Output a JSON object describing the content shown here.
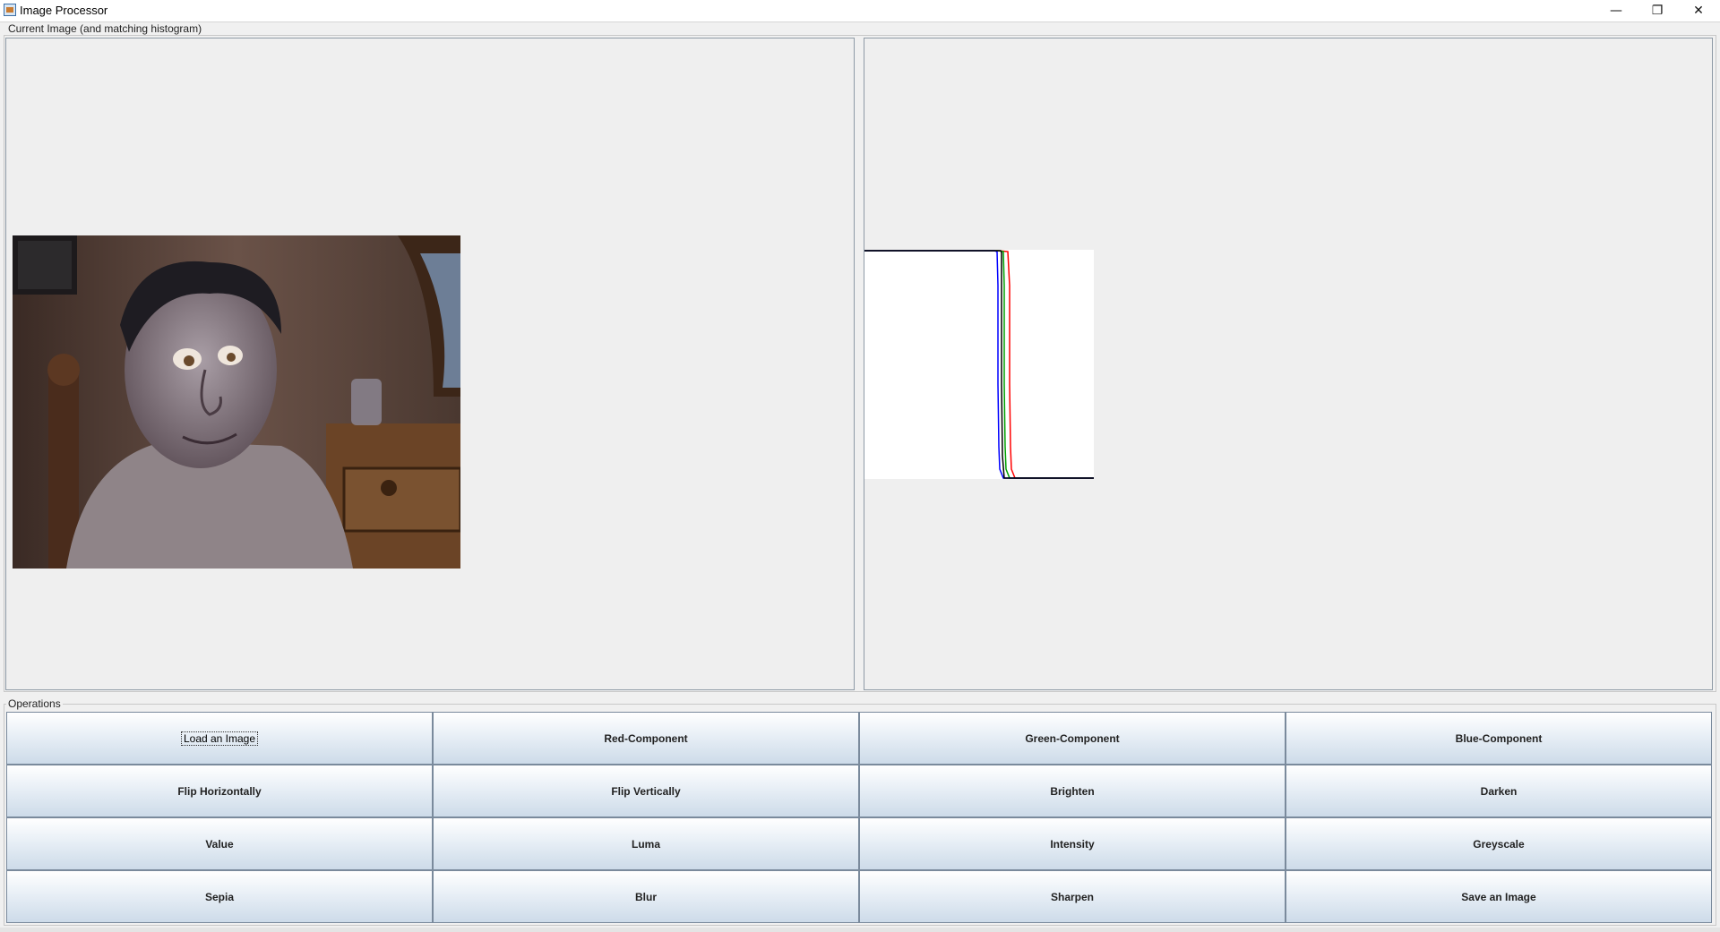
{
  "window": {
    "title": "Image Processor",
    "minimize_glyph": "—",
    "maximize_glyph": "❐",
    "close_glyph": "✕"
  },
  "image_group": {
    "title": "Current Image (and matching histogram)"
  },
  "operations": {
    "title": "Operations",
    "buttons": [
      "Load an Image",
      "Red-Component",
      "Green-Component",
      "Blue-Component",
      "Flip Horizontally",
      "Flip Vertically",
      "Brighten",
      "Darken",
      "Value",
      "Luma",
      "Intensity",
      "Greyscale",
      "Sepia",
      "Blur",
      "Sharpen",
      "Save an Image"
    ]
  },
  "icons": {
    "app": "java-app-icon",
    "minimize": "minimize-icon",
    "maximize": "restore-icon",
    "close": "close-icon"
  },
  "colors": {
    "histogram_red": "#ff0000",
    "histogram_green": "#00a000",
    "histogram_blue": "#0000ff",
    "histogram_black": "#000000"
  }
}
